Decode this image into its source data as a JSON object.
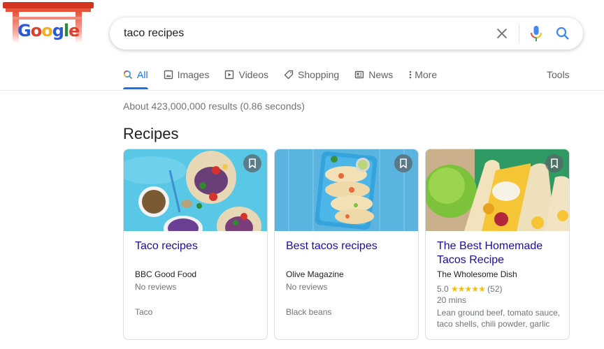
{
  "logo": {
    "alt": "Google Doodle",
    "letters": [
      "G",
      "o",
      "o",
      "g",
      "l",
      "e"
    ]
  },
  "search": {
    "query": "taco recipes",
    "clear_icon": "close-icon",
    "voice_icon": "mic-icon",
    "search_icon": "search-icon"
  },
  "tabs": [
    {
      "label": "All",
      "icon": "search-icon",
      "active": true
    },
    {
      "label": "Images",
      "icon": "image-icon"
    },
    {
      "label": "Videos",
      "icon": "play-icon"
    },
    {
      "label": "Shopping",
      "icon": "tag-icon"
    },
    {
      "label": "News",
      "icon": "newspaper-icon"
    },
    {
      "label": "More",
      "icon": "more-vert-icon"
    }
  ],
  "tools_label": "Tools",
  "result_stats": "About 423,000,000 results (0.86 seconds)",
  "section_title": "Recipes",
  "recipes": [
    {
      "title": "Taco recipes",
      "source": "BBC Good Food",
      "reviews": "No reviews",
      "ingredients": "Taco"
    },
    {
      "title": "Best tacos recipes",
      "source": "Olive Magazine",
      "reviews": "No reviews",
      "ingredients": "Black beans"
    },
    {
      "title": "The Best Homemade Tacos Recipe",
      "source": "The Wholesome Dish",
      "rating": "5.0",
      "stars": "★★★★★",
      "rating_value": 5,
      "rating_count": "(52)",
      "time": "20 mins",
      "ingredients": "Lean ground beef, tomato sauce, taco shells, chili powder, garlic"
    }
  ],
  "colors": {
    "accent": "#1a73e8",
    "link": "#1a0dab",
    "muted": "#70757a",
    "star": "#fbbc04"
  }
}
